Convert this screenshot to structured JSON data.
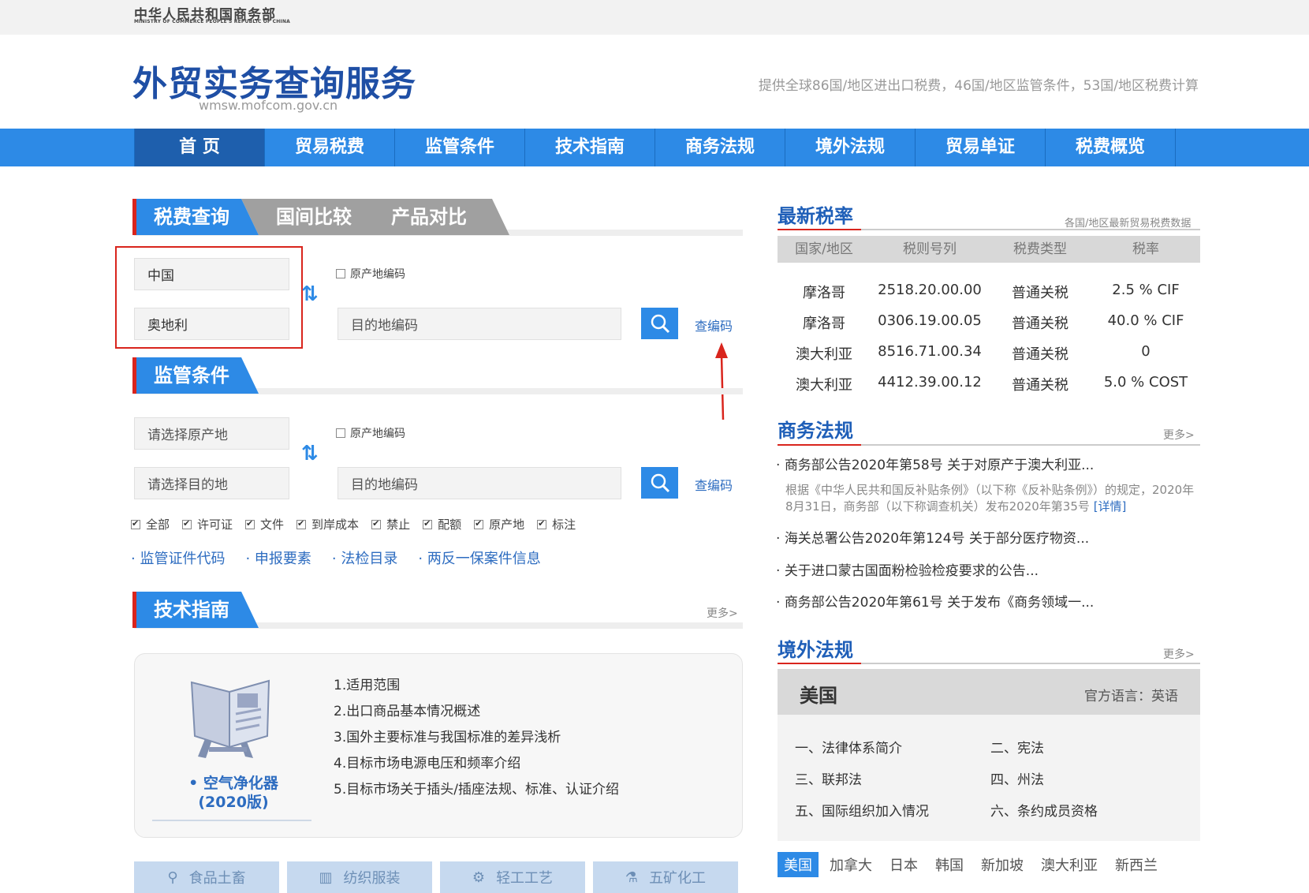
{
  "topbar": {
    "ministry_cn": "中华人民共和国商务部",
    "ministry_en": "MINISTRY OF COMMERCE PEOPLE'S REPUBLIC OF CHINA"
  },
  "header": {
    "title": "外贸实务查询服务",
    "domain": "wmsw.mofcom.gov.cn",
    "tagline": "提供全球86国/地区进出口税费，46国/地区监管条件，53国/地区税费计算"
  },
  "nav": [
    "首 页",
    "贸易税费",
    "监管条件",
    "技术指南",
    "商务法规",
    "境外法规",
    "贸易单证",
    "税费概览"
  ],
  "tax_query": {
    "tabs": [
      "税费查询",
      "国间比较",
      "产品对比"
    ],
    "origin_value": "中国",
    "dest_value": "奥地利",
    "origin_code_label": "原产地编码",
    "dest_code_placeholder": "目的地编码",
    "lookup_label": "查编码"
  },
  "supervision": {
    "title": "监管条件",
    "origin_placeholder": "请选择原产地",
    "dest_placeholder": "请选择目的地",
    "origin_code_label": "原产地编码",
    "dest_code_placeholder": "目的地编码",
    "lookup_label": "查编码",
    "filters": [
      "全部",
      "许可证",
      "文件",
      "到岸成本",
      "禁止",
      "配额",
      "原产地",
      "标注"
    ],
    "quick_links": [
      "监管证件代码",
      "申报要素",
      "法检目录",
      "两反一保案件信息"
    ]
  },
  "tech_guide": {
    "title": "技术指南",
    "more": "更多>",
    "product": "• 空气净化器",
    "edition": "(2020版)",
    "items": [
      "1.适用范围",
      "2.出口商品基本情况概述",
      "3.国外主要标准与我国标准的差异浅析",
      "4.目标市场电源电压和频率介绍",
      "5.目标市场关于插头/插座法规、标准、认证介绍"
    ]
  },
  "categories": [
    "食品土畜",
    "纺织服装",
    "轻工工艺",
    "五矿化工"
  ],
  "latest_rates": {
    "title": "最新税率",
    "subtitle": "各国/地区最新贸易税费数据",
    "headers": [
      "国家/地区",
      "税则号列",
      "税费类型",
      "税率"
    ],
    "rows": [
      [
        "摩洛哥",
        "2518.20.00.00",
        "普通关税",
        "2.5 % CIF"
      ],
      [
        "摩洛哥",
        "0306.19.00.05",
        "普通关税",
        "40.0 % CIF"
      ],
      [
        "澳大利亚",
        "8516.71.00.34",
        "普通关税",
        "0"
      ],
      [
        "澳大利亚",
        "4412.39.00.12",
        "普通关税",
        "5.0 % COST"
      ]
    ]
  },
  "commerce_law": {
    "title": "商务法规",
    "more": "更多>",
    "items": [
      "商务部公告2020年第58号 关于对原产于澳大利亚...",
      "海关总署公告2020年第124号 关于部分医疗物资...",
      "关于进口蒙古国面粉检验检疫要求的公告...",
      "商务部公告2020年第61号 关于发布《商务领域一..."
    ],
    "desc": "根据《中华人民共和国反补贴条例》（以下称《反补贴条例》）的规定，2020年8月31日，商务部（以下称调查机关）发布2020年第35号",
    "detail": "[详情]"
  },
  "foreign_law": {
    "title": "境外法规",
    "more": "更多>",
    "country": "美国",
    "language": "官方语言：英语",
    "items": [
      "一、法律体系简介",
      "二、宪法",
      "三、联邦法",
      "四、州法",
      "五、国际组织加入情况",
      "六、条约成员资格"
    ],
    "country_tabs": [
      "美国",
      "加拿大",
      "日本",
      "韩国",
      "新加坡",
      "澳大利亚",
      "新西兰"
    ]
  },
  "colors": {
    "primary": "#2d8ae6",
    "nav_active": "#1e5fad",
    "accent_red": "#d9251d",
    "title_blue": "#1f4fa5"
  }
}
